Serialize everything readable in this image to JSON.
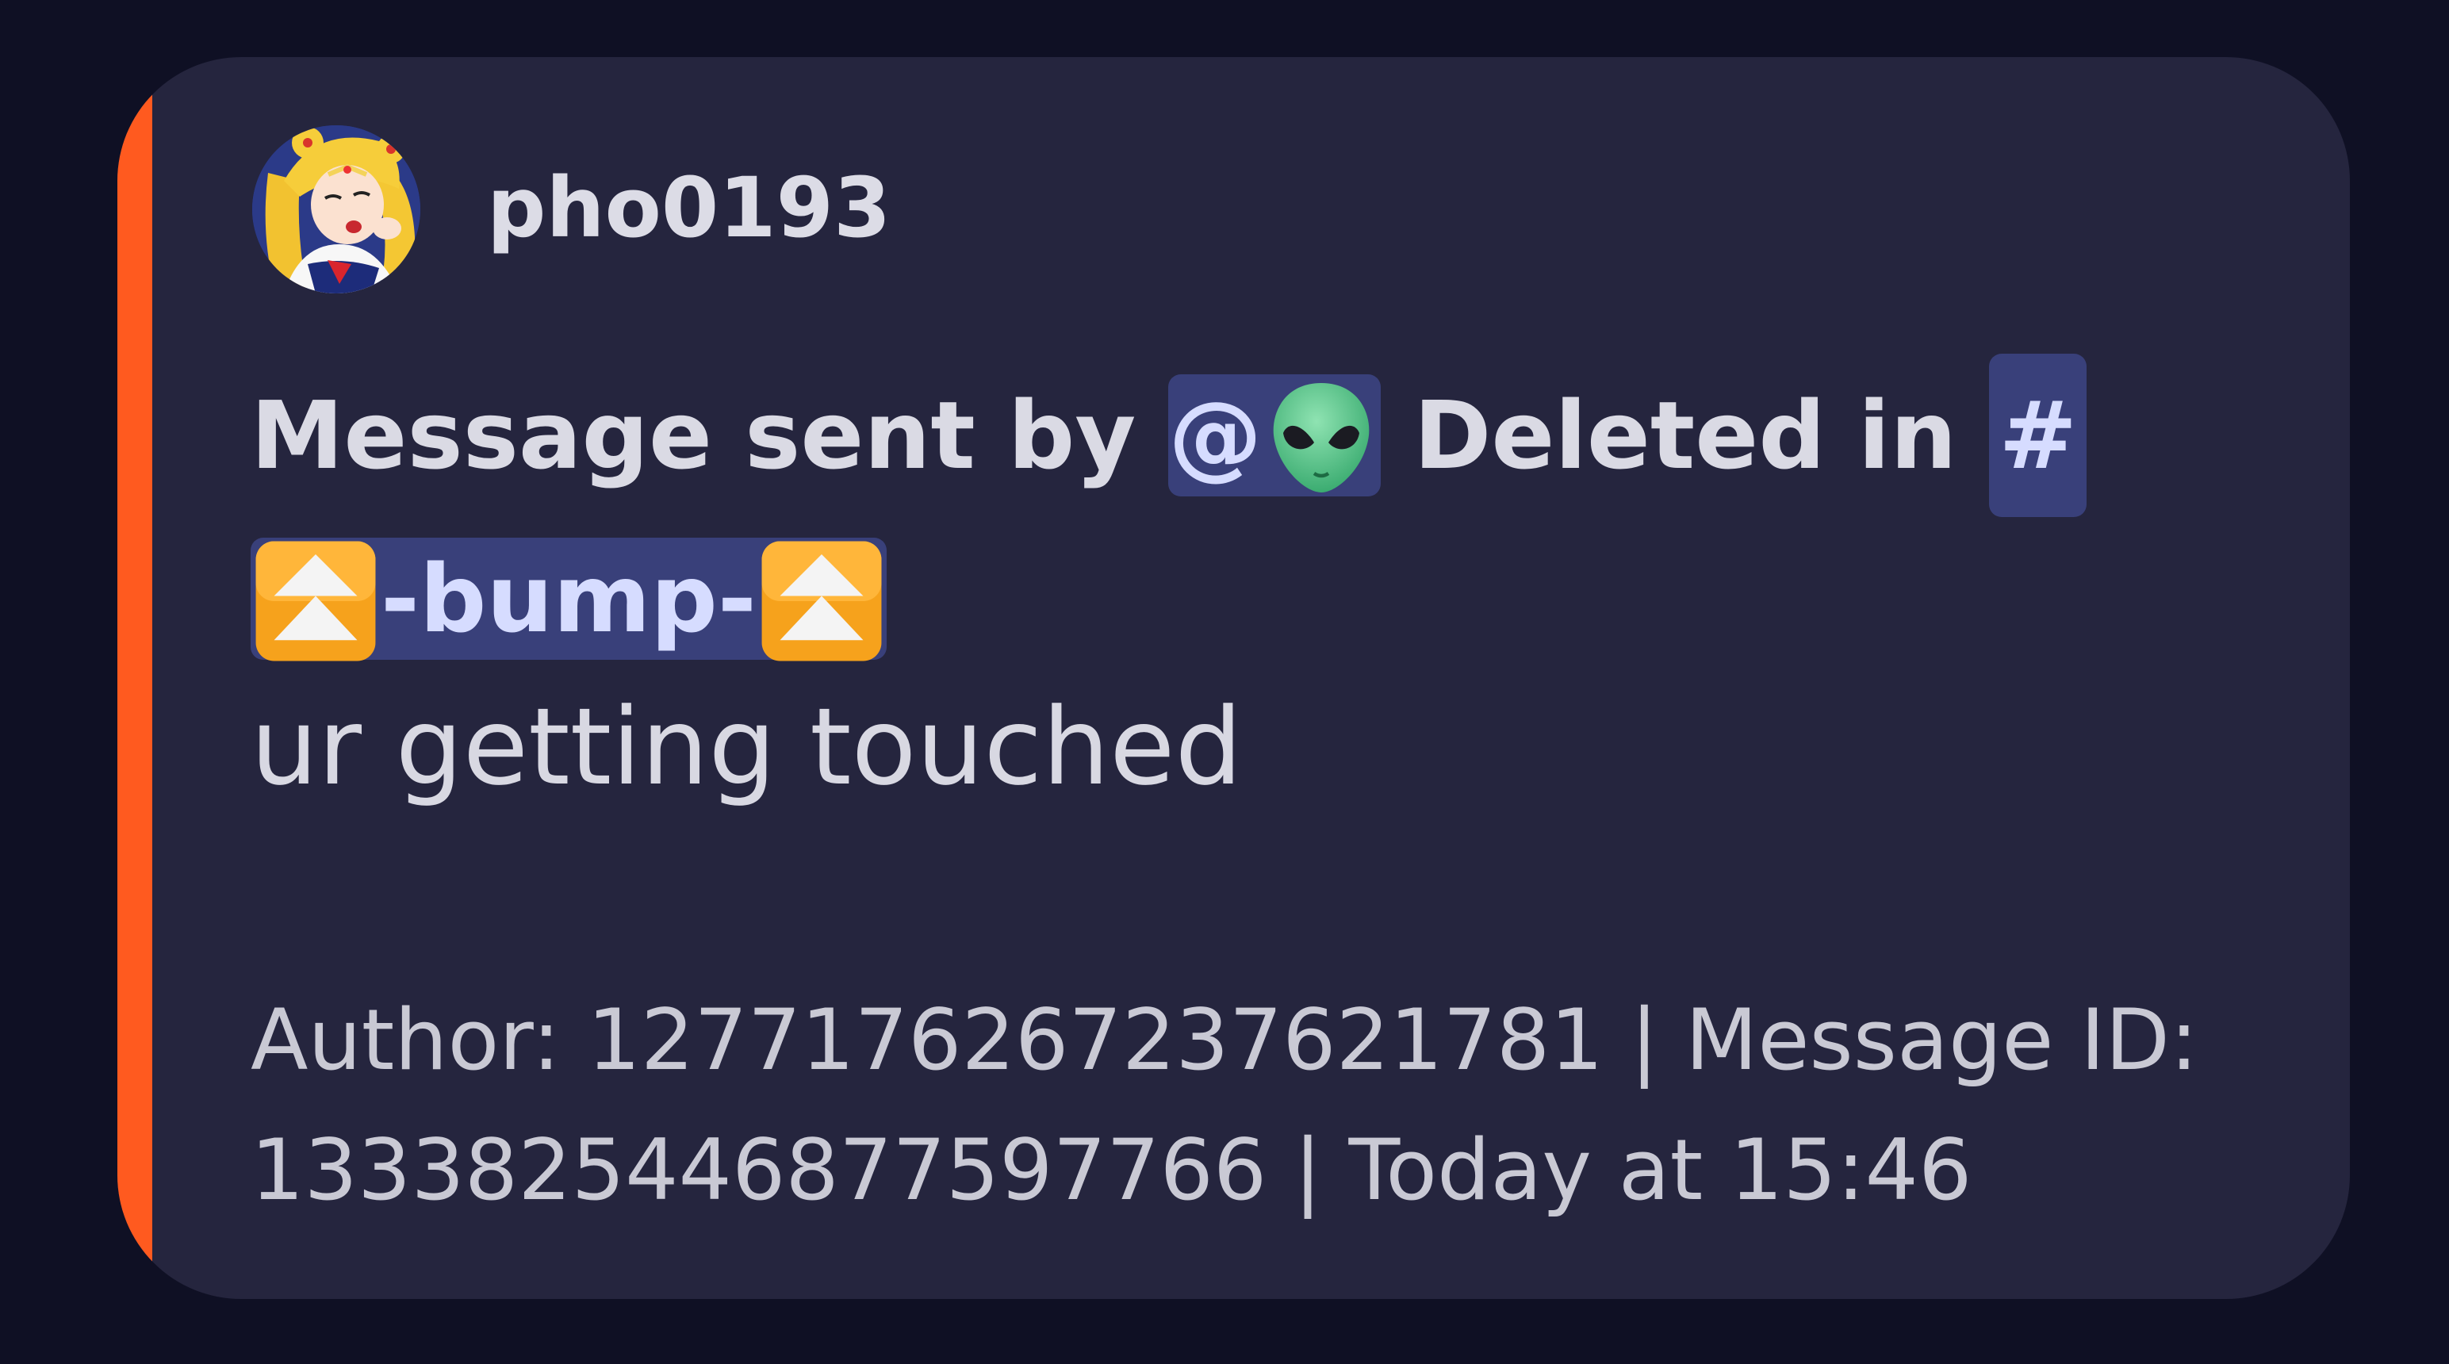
{
  "embed": {
    "accent_color": "#ff5a1f",
    "author": {
      "name": "pho0193",
      "avatar": "sailor-moon-avatar"
    },
    "title": {
      "prefix": "Message sent by ",
      "mention_at": "@",
      "mention_emoji": "alien-emoji",
      "middle": " Deleted in ",
      "channel_hash": "#",
      "channel_emoji_left": "double-up-arrow-emoji",
      "channel_name": "-bump-",
      "channel_emoji_right": "double-up-arrow-emoji"
    },
    "description": "ur getting touched",
    "footer": {
      "text": "Author: 1277176267237621781 | Message ID: 1333825446877597766 | Today at 15:46"
    }
  }
}
